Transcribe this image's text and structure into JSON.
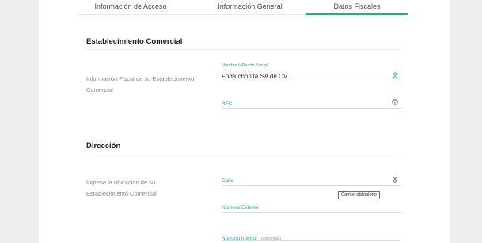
{
  "tabs": [
    {
      "label": "Información de Acceso"
    },
    {
      "label": "Información General"
    },
    {
      "label": "Datos Fiscales"
    }
  ],
  "establecimiento": {
    "title": "Establecimiento Comercial",
    "description": "Información Fiscal de su Establecimiento Comercial",
    "razon_social": {
      "label": "Nombre ó Razón Social",
      "value": "Foda chonita SA de CV"
    },
    "rfc": {
      "placeholder": "RFC"
    }
  },
  "direccion": {
    "title": "Dirección",
    "description": "Ingrese la ubicación de su Establecimiento Comercial",
    "calle": {
      "placeholder": "Calle"
    },
    "tooltip": "Campo obligatorio",
    "numero_exterior": {
      "placeholder": "Número Exterior"
    },
    "numero_interior": {
      "label": "Número Interior",
      "optional": "(Opcional)"
    }
  },
  "colors": {
    "accent": "#2aa6a0",
    "background": "#efefef"
  }
}
